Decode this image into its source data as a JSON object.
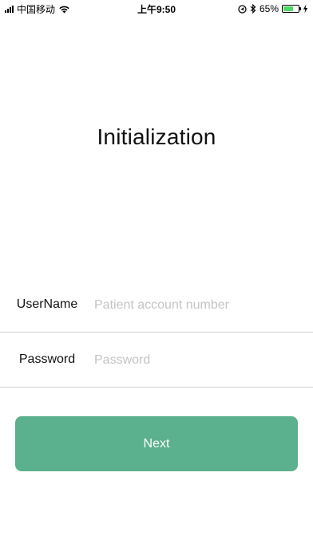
{
  "status_bar": {
    "carrier": "中国移动",
    "time": "上午9:50",
    "battery_percent": "65%",
    "battery_level": 0.65,
    "battery_color": "#4cd964",
    "icons": [
      "signal-icon",
      "wifi-icon",
      "location-icon",
      "bluetooth-icon",
      "battery-icon",
      "charging-icon"
    ]
  },
  "page": {
    "title": "Initialization"
  },
  "form": {
    "username": {
      "label": "UserName",
      "value": "",
      "placeholder": "Patient account number"
    },
    "password": {
      "label": "Password",
      "value": "",
      "placeholder": "Password"
    }
  },
  "actions": {
    "next_label": "Next",
    "accent_color": "#5bb08d"
  }
}
